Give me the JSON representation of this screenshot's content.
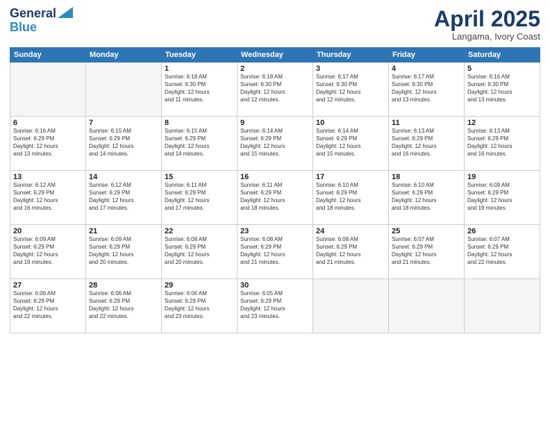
{
  "logo": {
    "line1": "General",
    "line2": "Blue"
  },
  "title": "April 2025",
  "subtitle": "Langama, Ivory Coast",
  "weekdays": [
    "Sunday",
    "Monday",
    "Tuesday",
    "Wednesday",
    "Thursday",
    "Friday",
    "Saturday"
  ],
  "weeks": [
    [
      {
        "day": "",
        "detail": ""
      },
      {
        "day": "",
        "detail": ""
      },
      {
        "day": "1",
        "detail": "Sunrise: 6:18 AM\nSunset: 6:30 PM\nDaylight: 12 hours\nand 11 minutes."
      },
      {
        "day": "2",
        "detail": "Sunrise: 6:18 AM\nSunset: 6:30 PM\nDaylight: 12 hours\nand 12 minutes."
      },
      {
        "day": "3",
        "detail": "Sunrise: 6:17 AM\nSunset: 6:30 PM\nDaylight: 12 hours\nand 12 minutes."
      },
      {
        "day": "4",
        "detail": "Sunrise: 6:17 AM\nSunset: 6:30 PM\nDaylight: 12 hours\nand 13 minutes."
      },
      {
        "day": "5",
        "detail": "Sunrise: 6:16 AM\nSunset: 6:30 PM\nDaylight: 12 hours\nand 13 minutes."
      }
    ],
    [
      {
        "day": "6",
        "detail": "Sunrise: 6:16 AM\nSunset: 6:29 PM\nDaylight: 12 hours\nand 13 minutes."
      },
      {
        "day": "7",
        "detail": "Sunrise: 6:15 AM\nSunset: 6:29 PM\nDaylight: 12 hours\nand 14 minutes."
      },
      {
        "day": "8",
        "detail": "Sunrise: 6:15 AM\nSunset: 6:29 PM\nDaylight: 12 hours\nand 14 minutes."
      },
      {
        "day": "9",
        "detail": "Sunrise: 6:14 AM\nSunset: 6:29 PM\nDaylight: 12 hours\nand 15 minutes."
      },
      {
        "day": "10",
        "detail": "Sunrise: 6:14 AM\nSunset: 6:29 PM\nDaylight: 12 hours\nand 15 minutes."
      },
      {
        "day": "11",
        "detail": "Sunrise: 6:13 AM\nSunset: 6:29 PM\nDaylight: 12 hours\nand 16 minutes."
      },
      {
        "day": "12",
        "detail": "Sunrise: 6:13 AM\nSunset: 6:29 PM\nDaylight: 12 hours\nand 16 minutes."
      }
    ],
    [
      {
        "day": "13",
        "detail": "Sunrise: 6:12 AM\nSunset: 6:29 PM\nDaylight: 12 hours\nand 16 minutes."
      },
      {
        "day": "14",
        "detail": "Sunrise: 6:12 AM\nSunset: 6:29 PM\nDaylight: 12 hours\nand 17 minutes."
      },
      {
        "day": "15",
        "detail": "Sunrise: 6:11 AM\nSunset: 6:29 PM\nDaylight: 12 hours\nand 17 minutes."
      },
      {
        "day": "16",
        "detail": "Sunrise: 6:11 AM\nSunset: 6:29 PM\nDaylight: 12 hours\nand 18 minutes."
      },
      {
        "day": "17",
        "detail": "Sunrise: 6:10 AM\nSunset: 6:29 PM\nDaylight: 12 hours\nand 18 minutes."
      },
      {
        "day": "18",
        "detail": "Sunrise: 6:10 AM\nSunset: 6:29 PM\nDaylight: 12 hours\nand 18 minutes."
      },
      {
        "day": "19",
        "detail": "Sunrise: 6:09 AM\nSunset: 6:29 PM\nDaylight: 12 hours\nand 19 minutes."
      }
    ],
    [
      {
        "day": "20",
        "detail": "Sunrise: 6:09 AM\nSunset: 6:29 PM\nDaylight: 12 hours\nand 19 minutes."
      },
      {
        "day": "21",
        "detail": "Sunrise: 6:09 AM\nSunset: 6:29 PM\nDaylight: 12 hours\nand 20 minutes."
      },
      {
        "day": "22",
        "detail": "Sunrise: 6:08 AM\nSunset: 6:29 PM\nDaylight: 12 hours\nand 20 minutes."
      },
      {
        "day": "23",
        "detail": "Sunrise: 6:08 AM\nSunset: 6:29 PM\nDaylight: 12 hours\nand 21 minutes."
      },
      {
        "day": "24",
        "detail": "Sunrise: 6:08 AM\nSunset: 6:29 PM\nDaylight: 12 hours\nand 21 minutes."
      },
      {
        "day": "25",
        "detail": "Sunrise: 6:07 AM\nSunset: 6:29 PM\nDaylight: 12 hours\nand 21 minutes."
      },
      {
        "day": "26",
        "detail": "Sunrise: 6:07 AM\nSunset: 6:29 PM\nDaylight: 12 hours\nand 22 minutes."
      }
    ],
    [
      {
        "day": "27",
        "detail": "Sunrise: 6:06 AM\nSunset: 6:29 PM\nDaylight: 12 hours\nand 22 minutes."
      },
      {
        "day": "28",
        "detail": "Sunrise: 6:06 AM\nSunset: 6:29 PM\nDaylight: 12 hours\nand 22 minutes."
      },
      {
        "day": "29",
        "detail": "Sunrise: 6:06 AM\nSunset: 6:29 PM\nDaylight: 12 hours\nand 23 minutes."
      },
      {
        "day": "30",
        "detail": "Sunrise: 6:05 AM\nSunset: 6:29 PM\nDaylight: 12 hours\nand 23 minutes."
      },
      {
        "day": "",
        "detail": ""
      },
      {
        "day": "",
        "detail": ""
      },
      {
        "day": "",
        "detail": ""
      }
    ]
  ]
}
